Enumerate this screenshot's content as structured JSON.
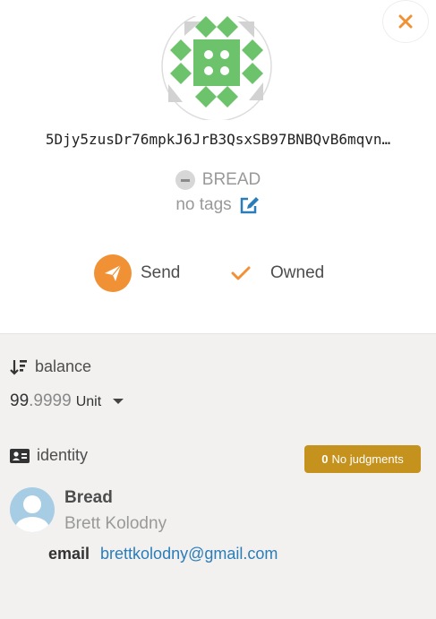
{
  "account": {
    "address": "5Djy5zusDr76mpkJ6JrB3QsxSB97BNBQvB6mqvn…",
    "name": "BREAD",
    "tags": "no tags",
    "identicon": "polkadot-identicon",
    "identicon_color": "#6cc36b"
  },
  "close": {
    "icon": "close-icon",
    "color": "#f19135"
  },
  "actions": {
    "send_label": "Send",
    "owned_label": "Owned",
    "accent_color": "#f19135"
  },
  "balance": {
    "label": "balance",
    "int_part": "99",
    "dec_part": ".9999",
    "unit": "Unit"
  },
  "identity": {
    "label": "identity",
    "judgment_count": "0",
    "judgment_text": "No judgments",
    "badge_color": "#c6921e",
    "display_name": "Bread",
    "legal_name": "Brett Kolodny",
    "email_label": "email",
    "email_value": "brettkolodny@gmail.com",
    "link_color": "#2b7db8"
  }
}
